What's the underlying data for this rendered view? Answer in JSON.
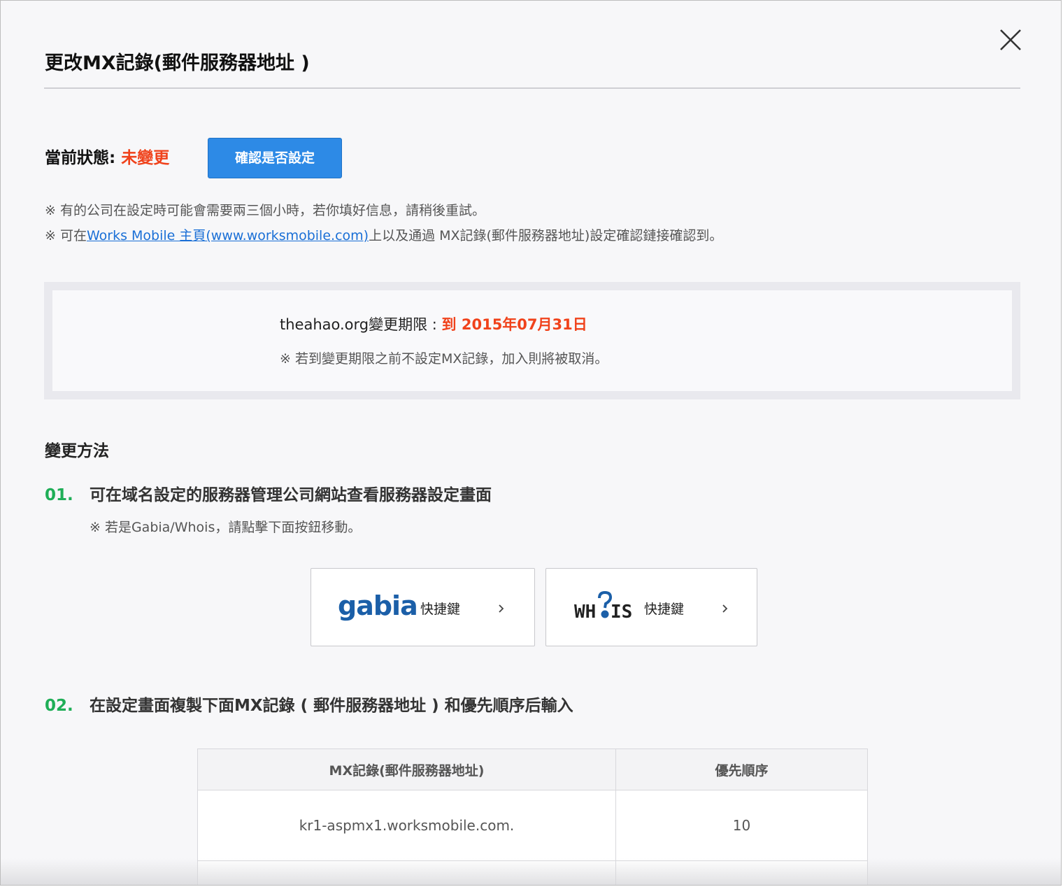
{
  "dialog": {
    "title": "更改MX記錄(郵件服務器地址 )",
    "close_icon": "close-icon"
  },
  "status": {
    "label": "當前狀態: ",
    "value": "未變更",
    "value_color": "#f0421b",
    "check_button": "確認是否設定",
    "button_color": "#2d8ae6"
  },
  "notes": {
    "note1": "※ 有的公司在設定時可能會需要兩三個小時，若你填好信息，請稍後重試。",
    "note2_prefix": "※ 可在",
    "note2_link": "Works Mobile 主頁(www.worksmobile.com)",
    "note2_suffix": "上以及通過 MX記錄(郵件服務器地址)設定確認鏈接確認到。"
  },
  "deadline": {
    "domain_label": "theahao.org變更期限 : ",
    "date": "到 2015年07月31日",
    "note": "※ 若到變更期限之前不設定MX記錄，加入則將被取消。"
  },
  "method": {
    "heading": "變更方法",
    "step1": {
      "num": "01.",
      "text": "可在域名設定的服務器管理公司網站查看服務器設定畫面",
      "note": "※ 若是Gabia/Whois，請點擊下面按鈕移動。"
    },
    "shortcuts": {
      "gabia_logo": "gabia.",
      "gabia_label": "快捷鍵",
      "whois_logo_left": "WH",
      "whois_logo_right": "IS",
      "whois_label": "快捷鍵",
      "chevron_icon": "chevron-right-icon"
    },
    "step2": {
      "num": "02.",
      "text": "在設定畫面複製下面MX記錄 ( 郵件服務器地址 ) 和優先順序后輸入"
    }
  },
  "mx_table": {
    "headers": [
      "MX記錄(郵件服務器地址)",
      "優先順序"
    ],
    "rows": [
      [
        "kr1-aspmx1.worksmobile.com.",
        "10"
      ]
    ]
  }
}
